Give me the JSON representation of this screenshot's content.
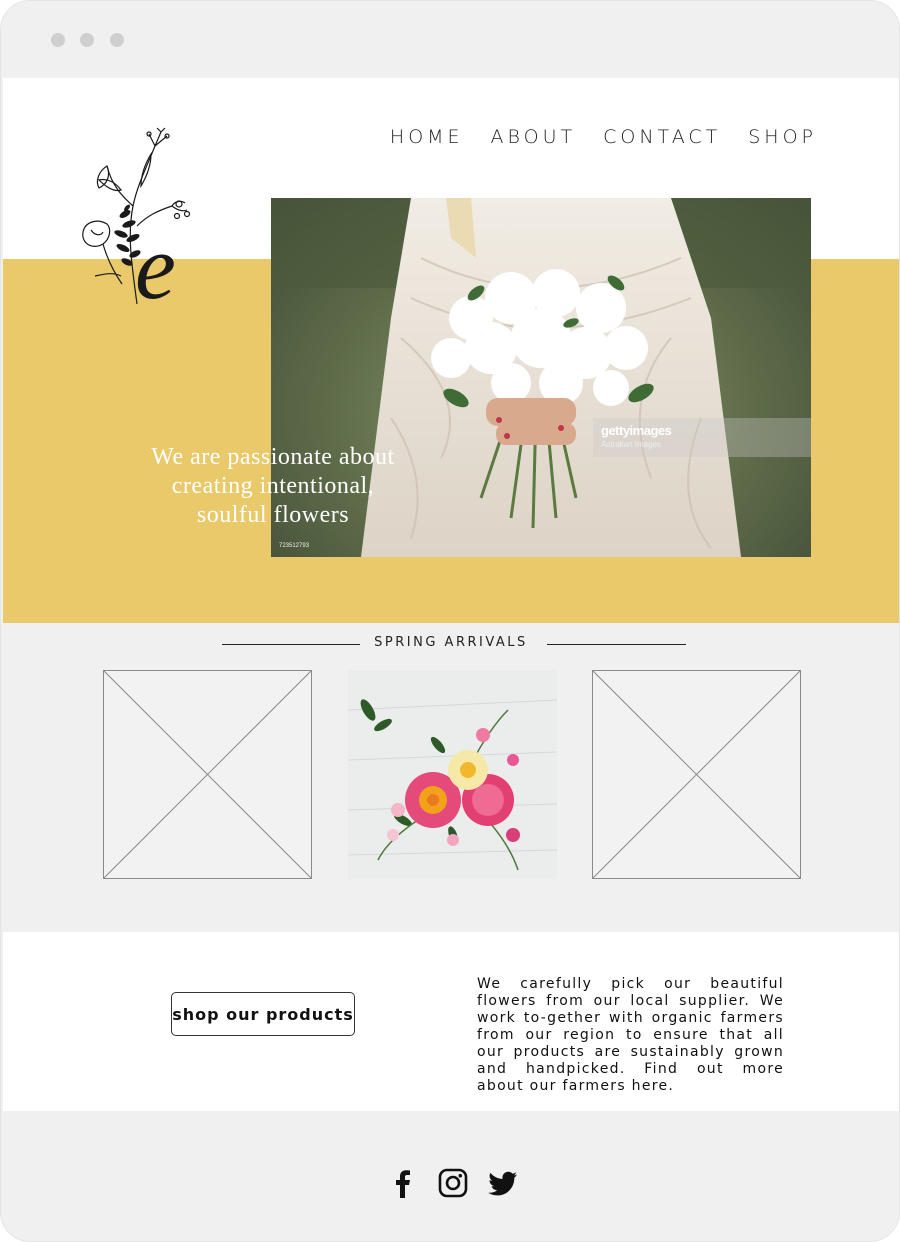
{
  "nav": {
    "items": [
      "HOME",
      "ABOUT",
      "CONTACT",
      "SHOP"
    ]
  },
  "hero": {
    "tagline_line1": "We are passionate about",
    "tagline_line2": "creating intentional,",
    "tagline_line3": "soulful flowers",
    "watermark_brand": "gettyimages",
    "watermark_credit": "Astrakan Images",
    "photo_id": "723512793"
  },
  "section": {
    "title": "SPRING ARRIVALS"
  },
  "info": {
    "button_label": "shop our products",
    "text": "We carefully pick our beautiful flowers from our local supplier. We work to-gether with organic farmers from our region to ensure that all our products are sustainably grown and handpicked. Find out more about our farmers here."
  },
  "colors": {
    "accent": "#eac96b",
    "background": "#f0f0f0",
    "text": "#1e1e1e"
  },
  "icons": [
    "facebook-icon",
    "instagram-icon",
    "twitter-icon"
  ]
}
